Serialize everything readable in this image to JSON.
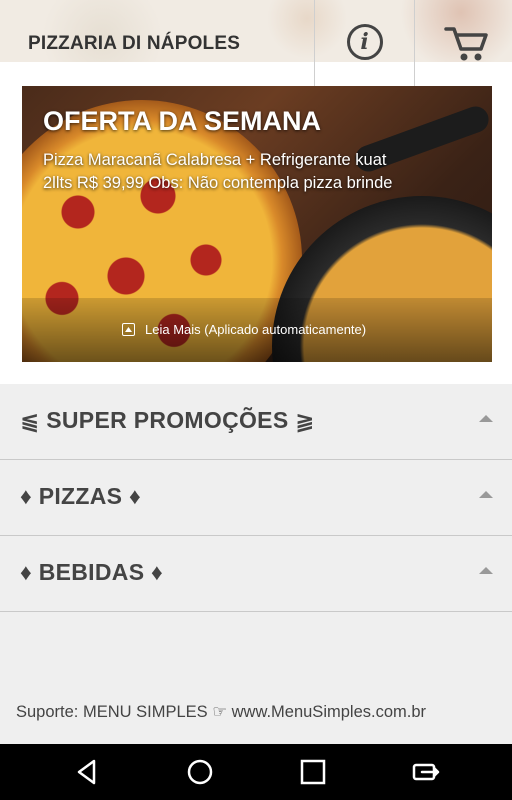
{
  "header": {
    "title": "PIZZARIA DI NÁPOLES",
    "info_icon": "info-icon",
    "cart_icon": "cart-icon"
  },
  "banner": {
    "title": "OFERTA DA SEMANA",
    "line1": "Pizza Maracanã Calabresa + Refrigerante kuat",
    "line2": "2llts R$ 39,99 Obs: Não contempla pizza brinde",
    "read_more": "Leia Mais (Aplicado automaticamente)"
  },
  "categories": [
    {
      "label": "⫹ SUPER PROMOÇÕES ⫺"
    },
    {
      "label": "♦ PIZZAS ♦"
    },
    {
      "label": "♦ BEBIDAS ♦"
    }
  ],
  "footer": {
    "support": "Suporte: MENU SIMPLES ☞ www.MenuSimples.com.br"
  },
  "navbar": {
    "icons": [
      "back-icon",
      "home-icon",
      "recents-icon",
      "rotate-icon"
    ]
  },
  "colors": {
    "header_text": "#333333",
    "category_bg": "#efefef",
    "category_text": "#444444",
    "navbar_bg": "#000000"
  }
}
